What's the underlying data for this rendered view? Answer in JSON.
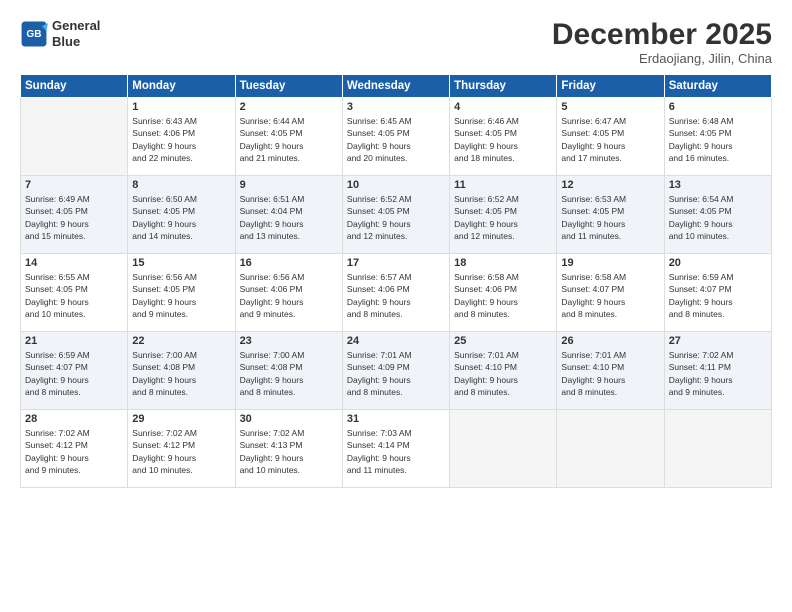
{
  "logo": {
    "line1": "General",
    "line2": "Blue"
  },
  "header": {
    "month": "December 2025",
    "location": "Erdaojiang, Jilin, China"
  },
  "weekdays": [
    "Sunday",
    "Monday",
    "Tuesday",
    "Wednesday",
    "Thursday",
    "Friday",
    "Saturday"
  ],
  "weeks": [
    [
      {
        "day": "",
        "info": ""
      },
      {
        "day": "1",
        "info": "Sunrise: 6:43 AM\nSunset: 4:06 PM\nDaylight: 9 hours\nand 22 minutes."
      },
      {
        "day": "2",
        "info": "Sunrise: 6:44 AM\nSunset: 4:05 PM\nDaylight: 9 hours\nand 21 minutes."
      },
      {
        "day": "3",
        "info": "Sunrise: 6:45 AM\nSunset: 4:05 PM\nDaylight: 9 hours\nand 20 minutes."
      },
      {
        "day": "4",
        "info": "Sunrise: 6:46 AM\nSunset: 4:05 PM\nDaylight: 9 hours\nand 18 minutes."
      },
      {
        "day": "5",
        "info": "Sunrise: 6:47 AM\nSunset: 4:05 PM\nDaylight: 9 hours\nand 17 minutes."
      },
      {
        "day": "6",
        "info": "Sunrise: 6:48 AM\nSunset: 4:05 PM\nDaylight: 9 hours\nand 16 minutes."
      }
    ],
    [
      {
        "day": "7",
        "info": "Sunrise: 6:49 AM\nSunset: 4:05 PM\nDaylight: 9 hours\nand 15 minutes."
      },
      {
        "day": "8",
        "info": "Sunrise: 6:50 AM\nSunset: 4:05 PM\nDaylight: 9 hours\nand 14 minutes."
      },
      {
        "day": "9",
        "info": "Sunrise: 6:51 AM\nSunset: 4:04 PM\nDaylight: 9 hours\nand 13 minutes."
      },
      {
        "day": "10",
        "info": "Sunrise: 6:52 AM\nSunset: 4:05 PM\nDaylight: 9 hours\nand 12 minutes."
      },
      {
        "day": "11",
        "info": "Sunrise: 6:52 AM\nSunset: 4:05 PM\nDaylight: 9 hours\nand 12 minutes."
      },
      {
        "day": "12",
        "info": "Sunrise: 6:53 AM\nSunset: 4:05 PM\nDaylight: 9 hours\nand 11 minutes."
      },
      {
        "day": "13",
        "info": "Sunrise: 6:54 AM\nSunset: 4:05 PM\nDaylight: 9 hours\nand 10 minutes."
      }
    ],
    [
      {
        "day": "14",
        "info": "Sunrise: 6:55 AM\nSunset: 4:05 PM\nDaylight: 9 hours\nand 10 minutes."
      },
      {
        "day": "15",
        "info": "Sunrise: 6:56 AM\nSunset: 4:05 PM\nDaylight: 9 hours\nand 9 minutes."
      },
      {
        "day": "16",
        "info": "Sunrise: 6:56 AM\nSunset: 4:06 PM\nDaylight: 9 hours\nand 9 minutes."
      },
      {
        "day": "17",
        "info": "Sunrise: 6:57 AM\nSunset: 4:06 PM\nDaylight: 9 hours\nand 8 minutes."
      },
      {
        "day": "18",
        "info": "Sunrise: 6:58 AM\nSunset: 4:06 PM\nDaylight: 9 hours\nand 8 minutes."
      },
      {
        "day": "19",
        "info": "Sunrise: 6:58 AM\nSunset: 4:07 PM\nDaylight: 9 hours\nand 8 minutes."
      },
      {
        "day": "20",
        "info": "Sunrise: 6:59 AM\nSunset: 4:07 PM\nDaylight: 9 hours\nand 8 minutes."
      }
    ],
    [
      {
        "day": "21",
        "info": "Sunrise: 6:59 AM\nSunset: 4:07 PM\nDaylight: 9 hours\nand 8 minutes."
      },
      {
        "day": "22",
        "info": "Sunrise: 7:00 AM\nSunset: 4:08 PM\nDaylight: 9 hours\nand 8 minutes."
      },
      {
        "day": "23",
        "info": "Sunrise: 7:00 AM\nSunset: 4:08 PM\nDaylight: 9 hours\nand 8 minutes."
      },
      {
        "day": "24",
        "info": "Sunrise: 7:01 AM\nSunset: 4:09 PM\nDaylight: 9 hours\nand 8 minutes."
      },
      {
        "day": "25",
        "info": "Sunrise: 7:01 AM\nSunset: 4:10 PM\nDaylight: 9 hours\nand 8 minutes."
      },
      {
        "day": "26",
        "info": "Sunrise: 7:01 AM\nSunset: 4:10 PM\nDaylight: 9 hours\nand 8 minutes."
      },
      {
        "day": "27",
        "info": "Sunrise: 7:02 AM\nSunset: 4:11 PM\nDaylight: 9 hours\nand 9 minutes."
      }
    ],
    [
      {
        "day": "28",
        "info": "Sunrise: 7:02 AM\nSunset: 4:12 PM\nDaylight: 9 hours\nand 9 minutes."
      },
      {
        "day": "29",
        "info": "Sunrise: 7:02 AM\nSunset: 4:12 PM\nDaylight: 9 hours\nand 10 minutes."
      },
      {
        "day": "30",
        "info": "Sunrise: 7:02 AM\nSunset: 4:13 PM\nDaylight: 9 hours\nand 10 minutes."
      },
      {
        "day": "31",
        "info": "Sunrise: 7:03 AM\nSunset: 4:14 PM\nDaylight: 9 hours\nand 11 minutes."
      },
      {
        "day": "",
        "info": ""
      },
      {
        "day": "",
        "info": ""
      },
      {
        "day": "",
        "info": ""
      }
    ]
  ]
}
